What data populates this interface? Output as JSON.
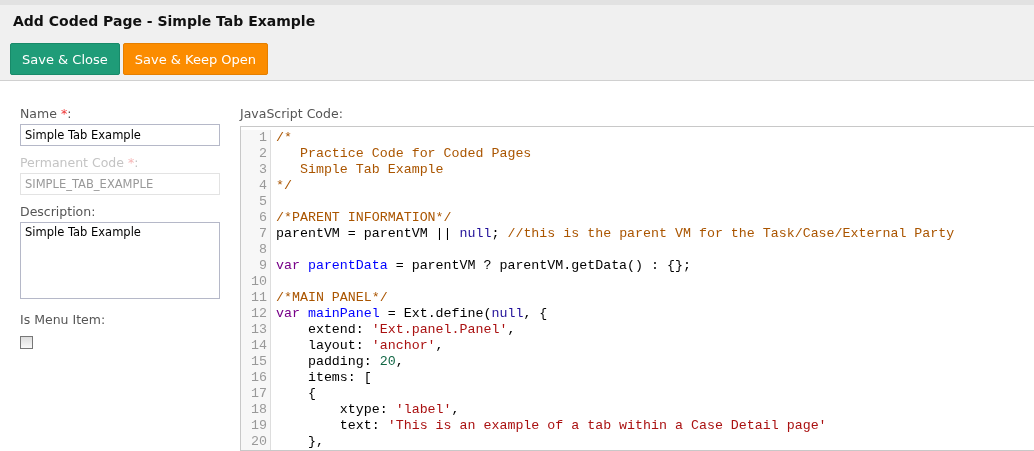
{
  "dialog": {
    "title": "Add Coded Page - Simple Tab Example"
  },
  "toolbar": {
    "buttons": [
      {
        "label": "Save & Close",
        "kind": "primary"
      },
      {
        "label": "Save & Keep Open",
        "kind": "warning"
      }
    ]
  },
  "form": {
    "fields": [
      {
        "kind": "text",
        "label": "Name",
        "required_mark": "*",
        "label_end": ":",
        "value": "Simple Tab Example",
        "disabled": false
      },
      {
        "kind": "text",
        "label": "Permanent Code",
        "required_mark": "*",
        "label_end": ":",
        "value": "SIMPLE_TAB_EXAMPLE",
        "disabled": true
      },
      {
        "kind": "textarea",
        "label": "Description:",
        "value": "Simple Tab Example",
        "disabled": false
      },
      {
        "kind": "checkbox",
        "label": "Is Menu Item:",
        "checked": false,
        "disabled": false
      }
    ]
  },
  "code_editor": {
    "label": "JavaScript Code:",
    "lines": [
      {
        "number": "1",
        "tokens": [
          {
            "kind": "comment",
            "text": "/*"
          }
        ]
      },
      {
        "number": "2",
        "tokens": [
          {
            "kind": "comment",
            "text": "   Practice Code for Coded Pages"
          }
        ]
      },
      {
        "number": "3",
        "tokens": [
          {
            "kind": "comment",
            "text": "   Simple Tab Example"
          }
        ]
      },
      {
        "number": "4",
        "tokens": [
          {
            "kind": "comment",
            "text": "*/"
          }
        ]
      },
      {
        "number": "5"
      },
      {
        "number": "6",
        "tokens": [
          {
            "kind": "comment",
            "text": "/*PARENT INFORMATION*/"
          }
        ]
      },
      {
        "number": "7",
        "tokens": [
          {
            "kind": "plain",
            "text": "parentVM = parentVM || "
          },
          {
            "kind": "atom",
            "text": "null"
          },
          {
            "kind": "plain",
            "text": "; "
          },
          {
            "kind": "comment",
            "text": "//this is the parent VM for the Task/Case/External Party"
          }
        ]
      },
      {
        "number": "8"
      },
      {
        "number": "9",
        "tokens": [
          {
            "kind": "keyword",
            "text": "var "
          },
          {
            "kind": "def",
            "text": "parentData"
          },
          {
            "kind": "plain",
            "text": " = parentVM ? parentVM.getData() : {};"
          }
        ]
      },
      {
        "number": "10"
      },
      {
        "number": "11",
        "tokens": [
          {
            "kind": "comment",
            "text": "/*MAIN PANEL*/"
          }
        ]
      },
      {
        "number": "12",
        "tokens": [
          {
            "kind": "keyword",
            "text": "var "
          },
          {
            "kind": "def",
            "text": "mainPanel"
          },
          {
            "kind": "plain",
            "text": " = Ext.define("
          },
          {
            "kind": "atom",
            "text": "null"
          },
          {
            "kind": "plain",
            "text": ", {"
          }
        ]
      },
      {
        "number": "13",
        "tokens": [
          {
            "kind": "plain",
            "text": "    extend: "
          },
          {
            "kind": "string",
            "text": "'Ext.panel.Panel'"
          },
          {
            "kind": "plain",
            "text": ","
          }
        ]
      },
      {
        "number": "14",
        "tokens": [
          {
            "kind": "plain",
            "text": "    layout: "
          },
          {
            "kind": "string",
            "text": "'anchor'"
          },
          {
            "kind": "plain",
            "text": ","
          }
        ]
      },
      {
        "number": "15",
        "tokens": [
          {
            "kind": "plain",
            "text": "    padding: "
          },
          {
            "kind": "number",
            "text": "20"
          },
          {
            "kind": "plain",
            "text": ","
          }
        ]
      },
      {
        "number": "16",
        "tokens": [
          {
            "kind": "plain",
            "text": "    items: ["
          }
        ]
      },
      {
        "number": "17",
        "tokens": [
          {
            "kind": "plain",
            "text": "    {"
          }
        ]
      },
      {
        "number": "18",
        "tokens": [
          {
            "kind": "plain",
            "text": "        xtype: "
          },
          {
            "kind": "string",
            "text": "'label'"
          },
          {
            "kind": "plain",
            "text": ","
          }
        ]
      },
      {
        "number": "19",
        "tokens": [
          {
            "kind": "plain",
            "text": "        text: "
          },
          {
            "kind": "string",
            "text": "'This is an example of a tab within a Case Detail page'"
          }
        ]
      },
      {
        "number": "20",
        "tokens": [
          {
            "kind": "plain",
            "text": "    },"
          }
        ]
      }
    ]
  }
}
